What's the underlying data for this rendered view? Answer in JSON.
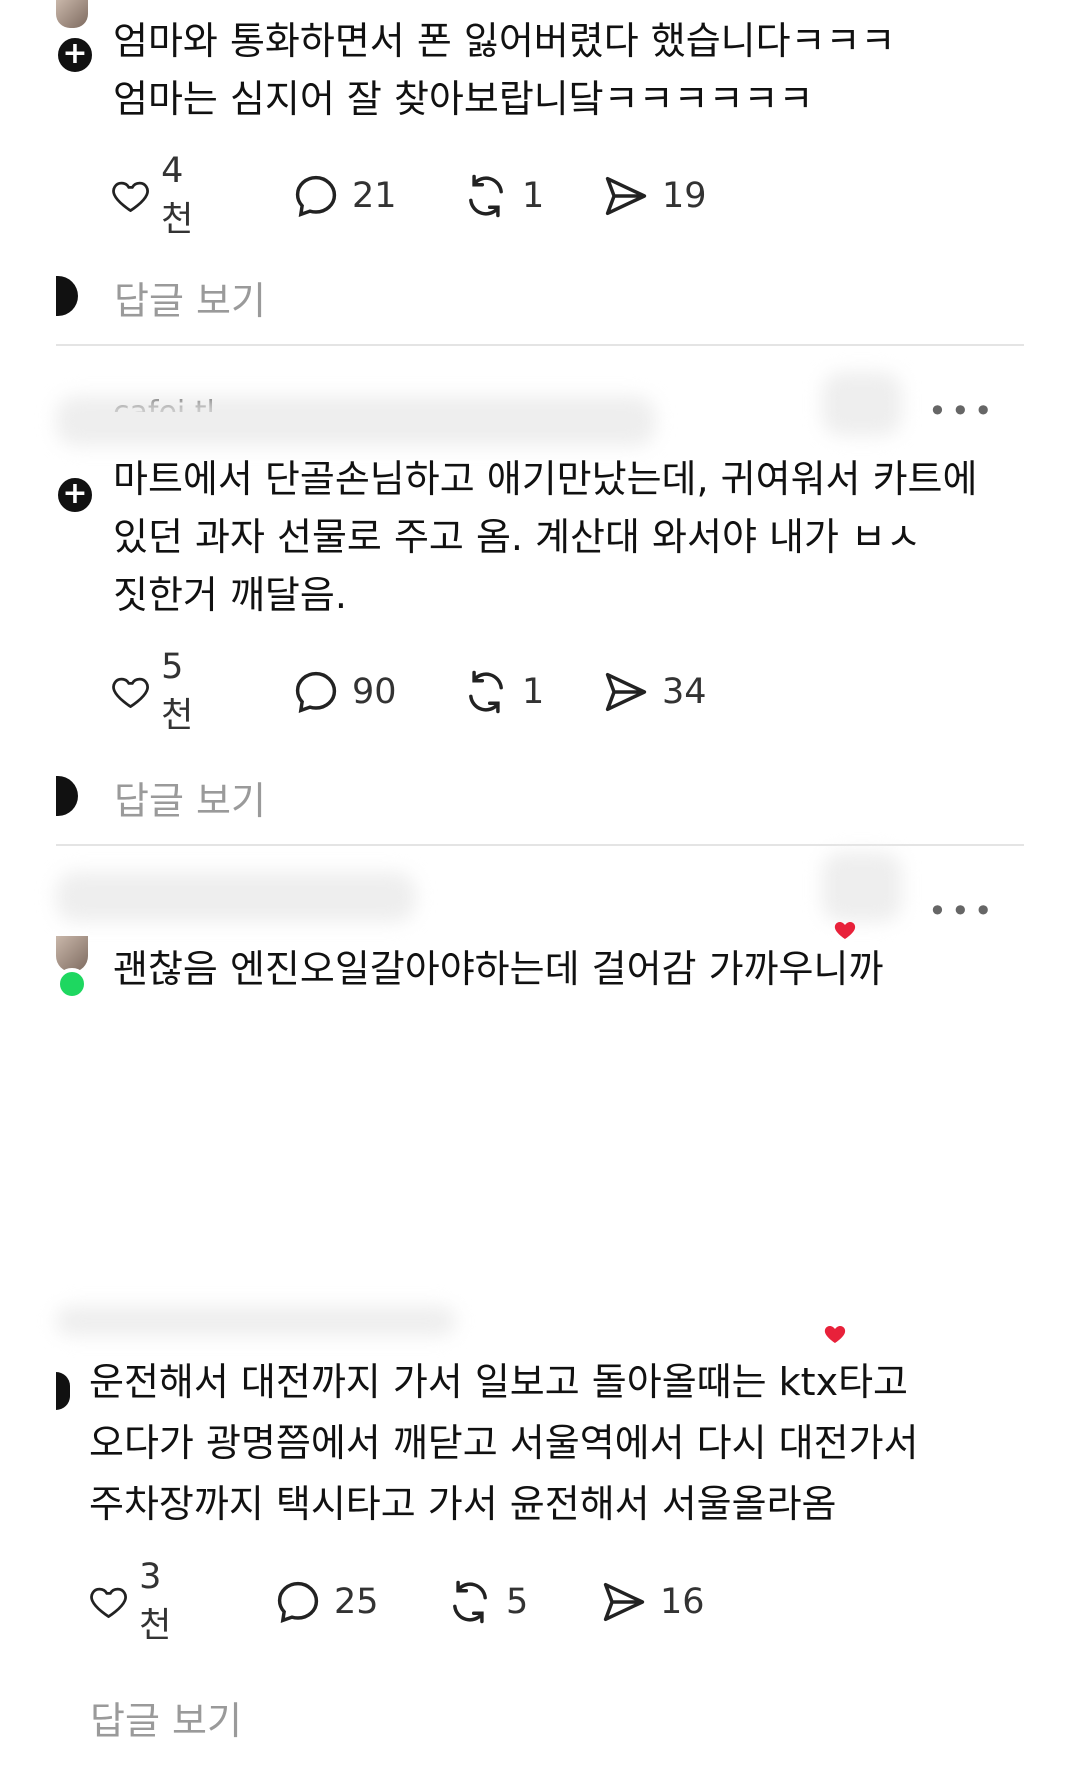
{
  "posts": [
    {
      "text": "엄마와 통화하면서 폰 잃어버렸다 했습니다ㅋㅋㅋ\n엄마는 심지어 잘 찾아보랍니닼ㅋㅋㅋㅋㅋㅋ",
      "likes": "4천",
      "comments": "21",
      "reposts": "1",
      "shares": "19",
      "reply_label": "답글 보기"
    },
    {
      "username_partial": "cafei tl",
      "text": "마트에서 단골손님하고 애기만났는데, 귀여워서 카트에\n있던 과자 선물로 주고 옴. 계산대 와서야 내가 ㅂㅅ\n짓한거 깨달음.",
      "likes": "5천",
      "comments": "90",
      "reposts": "1",
      "shares": "34",
      "reply_label": "답글 보기"
    },
    {
      "text": "괜찮음 엔진오일갈아야하는데 걸어감 가까우니까"
    },
    {
      "text": "운전해서 대전까지 가서 일보고 돌아올때는 ktx타고\n오다가  광명쯤에서 깨닫고 서울역에서 다시 대전가서\n주차장까지 택시타고 가서 윤전해서 서울올라옴",
      "likes": "3천",
      "comments": "25",
      "reposts": "5",
      "shares": "16",
      "reply_label": "답글 보기"
    }
  ],
  "icons": {
    "like": "heart-icon",
    "comment": "comment-bubble-icon",
    "repost": "repost-icon",
    "share": "share-send-icon",
    "more": "more-options-icon"
  },
  "more_glyph": "•••",
  "colors": {
    "online": "#1ed760",
    "muted": "#9a9a9a",
    "divider": "#e4e4e4"
  }
}
